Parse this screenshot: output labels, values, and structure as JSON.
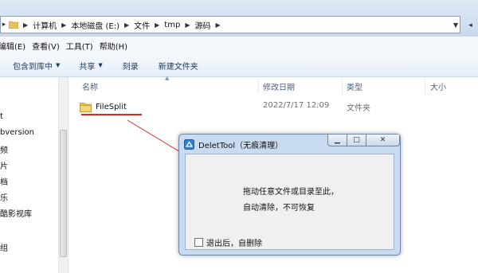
{
  "address_bar": {
    "breadcrumbs": [
      "计算机",
      "本地磁盘 (E:)",
      "文件",
      "tmp",
      "源码"
    ]
  },
  "menu": {
    "items": [
      "编辑(E)",
      "查看(V)",
      "工具(T)",
      "帮助(H)"
    ]
  },
  "toolbar": {
    "include_in_library": "包含到库中",
    "share": "共享",
    "burn": "刻录",
    "new_folder": "新建文件夹"
  },
  "nav_pane": {
    "items": [
      "t",
      "bversion",
      "频",
      "片",
      "档",
      "乐",
      "酷影视库",
      "组"
    ]
  },
  "columns": {
    "name": "名称",
    "date": "修改日期",
    "type": "类型",
    "size": "大小"
  },
  "files": [
    {
      "name": "FileSplit",
      "date": "2022/7/17 12:09",
      "type": "文件夹",
      "icon": "folder-icon"
    }
  ],
  "dialog": {
    "title": "DeletTool（无痕清理）",
    "message_line1": "拖动任意文件或目录至此，",
    "message_line2": "自动清除，不可恢复",
    "checkbox_label": "退出后，自删除",
    "checkbox_checked": false
  },
  "colors": {
    "annotation_red": "#e0261f",
    "dialog_frame": "#c8dbf0"
  }
}
